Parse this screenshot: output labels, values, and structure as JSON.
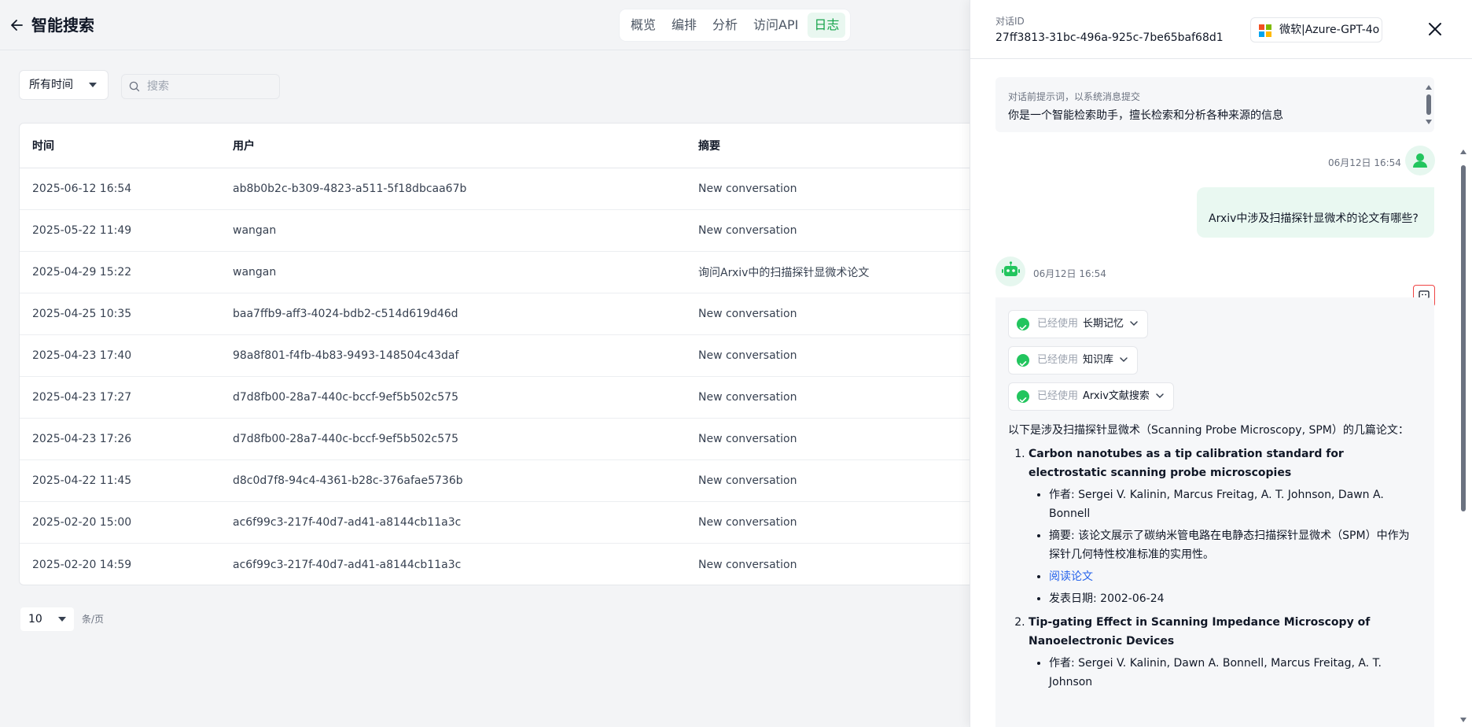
{
  "header": {
    "title": "智能搜索",
    "tabs": [
      "概览",
      "编排",
      "分析",
      "访问API",
      "日志"
    ],
    "active_tab": "日志"
  },
  "filters": {
    "time_range": "所有时间",
    "search_placeholder": "搜索"
  },
  "table": {
    "columns": [
      "时间",
      "用户",
      "摘要"
    ],
    "rows": [
      [
        "2025-06-12 16:54",
        "ab8b0b2c-b309-4823-a511-5f18dbcaa67b",
        "New conversation"
      ],
      [
        "2025-05-22 11:49",
        "wangan",
        "New conversation"
      ],
      [
        "2025-04-29 15:22",
        "wangan",
        "询问Arxiv中的扫描探针显微术论文"
      ],
      [
        "2025-04-25 10:35",
        "baa7ffb9-aff3-4024-bdb2-c514d619d46d",
        "New conversation"
      ],
      [
        "2025-04-23 17:40",
        "98a8f801-f4fb-4b83-9493-148504c43daf",
        "New conversation"
      ],
      [
        "2025-04-23 17:27",
        "d7d8fb00-28a7-440c-bccf-9ef5b502c575",
        "New conversation"
      ],
      [
        "2025-04-23 17:26",
        "d7d8fb00-28a7-440c-bccf-9ef5b502c575",
        "New conversation"
      ],
      [
        "2025-04-22 11:45",
        "d8c0d7f8-94c4-4361-b28c-376afae5736b",
        "New conversation"
      ],
      [
        "2025-02-20 15:00",
        "ac6f99c3-217f-40d7-ad41-a8144cb11a3c",
        "New conversation"
      ],
      [
        "2025-02-20 14:59",
        "ac6f99c3-217f-40d7-ad41-a8144cb11a3c",
        "New conversation"
      ]
    ]
  },
  "pagination": {
    "page_size": "10",
    "per_page_label": "条/页"
  },
  "drawer": {
    "id_label": "对话ID",
    "conversation_id": "27ff3813-31bc-496a-925c-7be65baf68d1",
    "model": "微软|Azure-GPT-4o",
    "system_prompt_label": "对话前提示词，以系统消息提交",
    "system_prompt": "你是一个智能检索助手，擅长检索和分析各种来源的信息",
    "user_message": {
      "time": "06月12日 16:54",
      "text": "Arxiv中涉及扫描探针显微术的论文有哪些?"
    },
    "bot_message": {
      "time": "06月12日 16:54",
      "tools": [
        {
          "status": "已经使用",
          "name": "长期记忆"
        },
        {
          "status": "已经使用",
          "name": "知识库"
        },
        {
          "status": "已经使用",
          "name": "Arxiv文献搜索"
        }
      ],
      "intro": "以下是涉及扫描探针显微术（Scanning Probe Microscopy, SPM）的几篇论文：",
      "papers": [
        {
          "title": "Carbon nanotubes as a tip calibration standard for electrostatic scanning probe microscopies",
          "authors": "作者: Sergei V. Kalinin, Marcus Freitag, A. T. Johnson, Dawn A. Bonnell",
          "abstract": "摘要: 该论文展示了碳纳米管电路在电静态扫描探针显微术（SPM）中作为探针几何特性校准标准的实用性。",
          "link": "阅读论文",
          "date": "发表日期: 2002-06-24"
        },
        {
          "title": "Tip-gating Effect in Scanning Impedance Microscopy of Nanoelectronic Devices",
          "authors": "作者: Sergei V. Kalinin, Dawn A. Bonnell, Marcus Freitag, A. T. Johnson"
        }
      ]
    }
  },
  "colors": {
    "accent": "#16a34a",
    "active_tab_bg": "#e9f7f0",
    "link": "#2563eb"
  }
}
